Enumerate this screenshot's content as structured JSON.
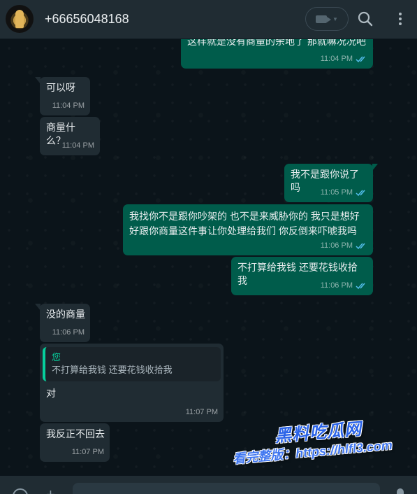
{
  "header": {
    "contact_name": "+66656048168",
    "icons": [
      "video-call-icon",
      "chevron-down-icon",
      "search-icon",
      "menu-icon"
    ]
  },
  "messages": [
    {
      "direction": "out",
      "text": "这样就是没有商量的余地了 那就嘛况况吧",
      "time": "11:04 PM",
      "status": "read"
    },
    {
      "direction": "in",
      "text": "可以呀",
      "time": "11:04 PM"
    },
    {
      "direction": "in",
      "text": "商量什么？",
      "time": "11:04 PM"
    },
    {
      "direction": "out",
      "text": "我不是跟你说了吗",
      "time": "11:05 PM",
      "status": "read"
    },
    {
      "direction": "out",
      "text": "我找你不是跟你吵架的 也不是来威胁你的 我只是想好好跟你商量这件事让你处理给我们 你反倒来吓唬我吗",
      "time": "11:06 PM",
      "status": "read"
    },
    {
      "direction": "out",
      "text": "不打算给我钱 还要花钱收拾我",
      "time": "11:06 PM",
      "status": "read"
    },
    {
      "direction": "in",
      "text": "没的商量",
      "time": "11:06 PM"
    },
    {
      "direction": "in",
      "quote_author": "您",
      "quote_text": "不打算给我钱 还要花钱收拾我",
      "text": "对",
      "time": "11:07 PM"
    },
    {
      "direction": "in",
      "text": "我反正不回去",
      "time": "11:07 PM"
    }
  ],
  "watermark": {
    "brand": "黑料吃瓜网",
    "url_line": "看完整版：https://hlfl3.com"
  },
  "colors": {
    "chat_bg": "#0b141a",
    "header_bg": "#202c33",
    "incoming_bubble": "#202c33",
    "outgoing_bubble": "#005c4b",
    "read_ticks": "#53bdeb",
    "quote_accent": "#06cf9c"
  }
}
